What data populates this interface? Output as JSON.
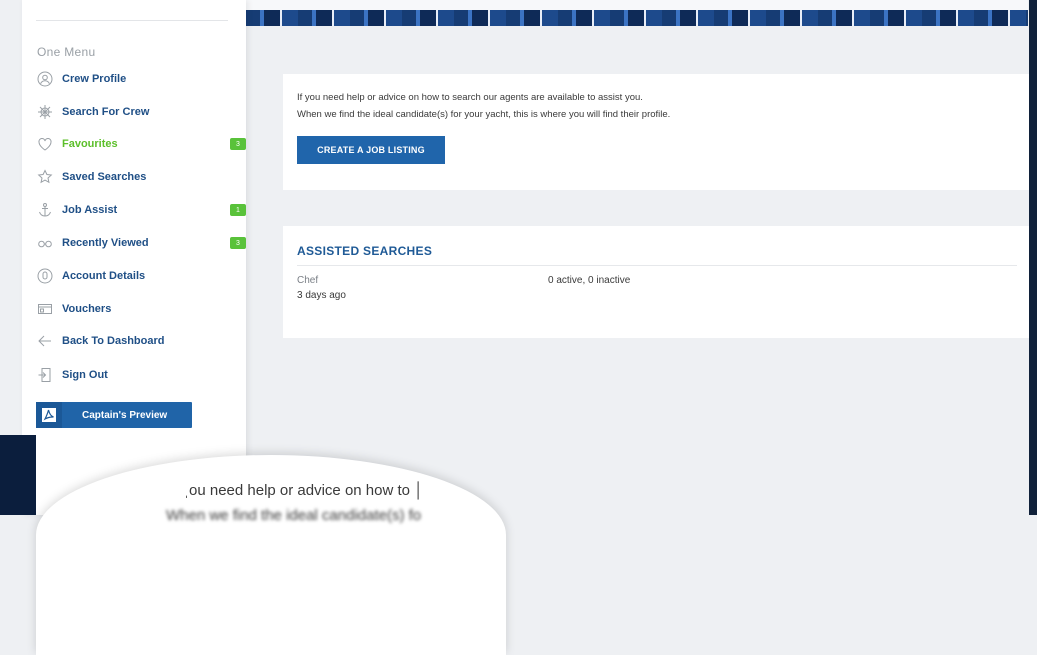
{
  "sidebar": {
    "heading": "One Menu",
    "items": [
      {
        "label": "Crew Profile",
        "icon": "user-circle-icon",
        "badge": ""
      },
      {
        "label": "Search For Crew",
        "icon": "helm-icon",
        "badge": ""
      },
      {
        "label": "Favourites",
        "icon": "heart-icon",
        "badge": "3",
        "active": true
      },
      {
        "label": "Saved Searches",
        "icon": "star-icon",
        "badge": ""
      },
      {
        "label": "Job Assist",
        "icon": "anchor-icon",
        "badge": "1"
      },
      {
        "label": "Recently Viewed",
        "icon": "glasses-icon",
        "badge": "3"
      },
      {
        "label": "Account Details",
        "icon": "account-icon",
        "badge": ""
      },
      {
        "label": "Vouchers",
        "icon": "voucher-icon",
        "badge": ""
      },
      {
        "label": "Back To Dashboard",
        "icon": "back-arrow-icon",
        "badge": ""
      },
      {
        "label": "Sign Out",
        "icon": "sign-out-icon",
        "badge": ""
      }
    ],
    "captain_preview": "Captain's Preview"
  },
  "help": {
    "line1": "If you need help or advice on how to search our agents are available to assist you.",
    "line2": "When we find the ideal candidate(s) for your yacht, this is where you will find their profile.",
    "create_button": "CREATE A JOB LISTING"
  },
  "assisted": {
    "title": "ASSISTED SEARCHES",
    "searches": [
      {
        "role": "Chef",
        "when": "3 days ago",
        "status": "0 active, 0 inactive"
      }
    ]
  },
  "magnifier": {
    "line1": "ˌou need help or advice on how to │",
    "line2": "When we find the ideal candidate(s) fo"
  },
  "colors": {
    "accent": "#2065ab",
    "active": "#5cbf2a",
    "badge": "#59c23a"
  }
}
